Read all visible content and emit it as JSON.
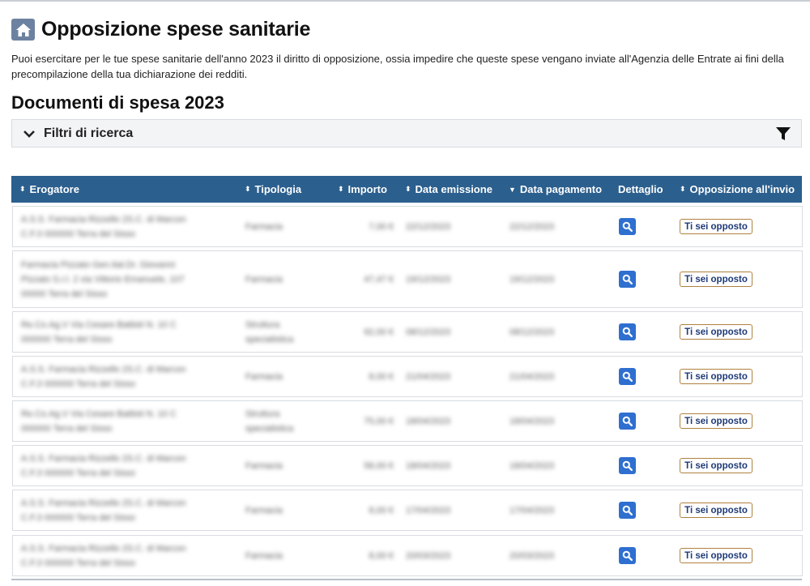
{
  "page": {
    "title": "Opposizione spese sanitarie",
    "intro": "Puoi esercitare per le tue spese sanitarie dell'anno 2023 il diritto di opposizione, ossia impedire che queste spese vengano inviate all'Agenzia delle Entrate ai fini della precompilazione della tua dichiarazione dei redditi.",
    "section_title": "Documenti di spesa 2023"
  },
  "filters": {
    "label": "Filtri di ricerca",
    "icon": "filter-icon"
  },
  "colors": {
    "header_bg": "#2b5f8e",
    "detail_button": "#2e6fd0",
    "badge_border": "#b0813f",
    "badge_text": "#1f3a78"
  },
  "table": {
    "columns": [
      {
        "label": "Erogatore",
        "sort": "both"
      },
      {
        "label": "Tipologia",
        "sort": "both"
      },
      {
        "label": "Importo",
        "sort": "both"
      },
      {
        "label": "Data emissione",
        "sort": "both"
      },
      {
        "label": "Data pagamento",
        "sort": "desc"
      },
      {
        "label": "Dettaglio",
        "sort": "none"
      },
      {
        "label": "Opposizione all'invio",
        "sort": "both"
      }
    ],
    "rows": [
      {
        "erogatore": "",
        "tipologia": "",
        "importo": "",
        "data_emissione": "",
        "data_pagamento": "",
        "opposizione": "Ti sei opposto"
      },
      {
        "erogatore": "",
        "tipologia": "",
        "importo": "",
        "data_emissione": "",
        "data_pagamento": "",
        "opposizione": "Ti sei opposto"
      },
      {
        "erogatore": "",
        "tipologia": "",
        "importo": "",
        "data_emissione": "",
        "data_pagamento": "",
        "opposizione": "Ti sei opposto"
      },
      {
        "erogatore": "",
        "tipologia": "",
        "importo": "",
        "data_emissione": "",
        "data_pagamento": "",
        "opposizione": "Ti sei opposto"
      },
      {
        "erogatore": "",
        "tipologia": "",
        "importo": "",
        "data_emissione": "",
        "data_pagamento": "",
        "opposizione": "Ti sei opposto"
      },
      {
        "erogatore": "",
        "tipologia": "",
        "importo": "",
        "data_emissione": "",
        "data_pagamento": "",
        "opposizione": "Ti sei opposto"
      },
      {
        "erogatore": "",
        "tipologia": "",
        "importo": "",
        "data_emissione": "",
        "data_pagamento": "",
        "opposizione": "Ti sei opposto"
      },
      {
        "erogatore": "",
        "tipologia": "",
        "importo": "",
        "data_emissione": "",
        "data_pagamento": "",
        "opposizione": "Ti sei opposto"
      }
    ]
  }
}
